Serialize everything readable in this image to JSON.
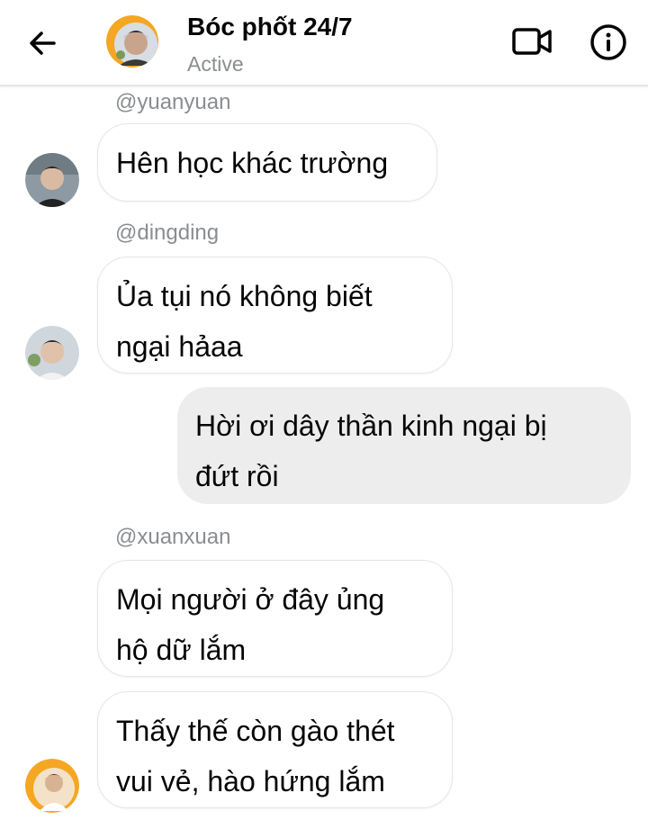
{
  "header": {
    "title": "Bóc phốt 24/7",
    "status": "Active",
    "back_icon": "arrow-left-icon",
    "video_icon": "video-camera-icon",
    "info_icon": "info-icon"
  },
  "colors": {
    "incoming_bubble": "#ffffff",
    "outgoing_bubble": "#ededed",
    "secondary_text": "#8a8d91",
    "avatar_ring": "#f5a623"
  },
  "messages": [
    {
      "sender": "@yuanyuan",
      "lines": [
        "Hên học khác trường"
      ],
      "direction": "incoming"
    },
    {
      "sender": "@dingding",
      "lines": [
        "Ủa tụi nó không biết",
        "ngại hảaa"
      ],
      "direction": "incoming"
    },
    {
      "sender": "",
      "lines": [
        "Hời ơi dây thần kinh ngại bị",
        "đứt rồi"
      ],
      "direction": "outgoing"
    },
    {
      "sender": "@xuanxuan",
      "lines": [
        "Mọi người ở đây ủng",
        "hộ dữ lắm"
      ],
      "direction": "incoming"
    },
    {
      "sender": "",
      "lines": [
        "Thấy thế còn gào thét",
        "vui vẻ, hào hứng lắm"
      ],
      "direction": "incoming"
    }
  ]
}
